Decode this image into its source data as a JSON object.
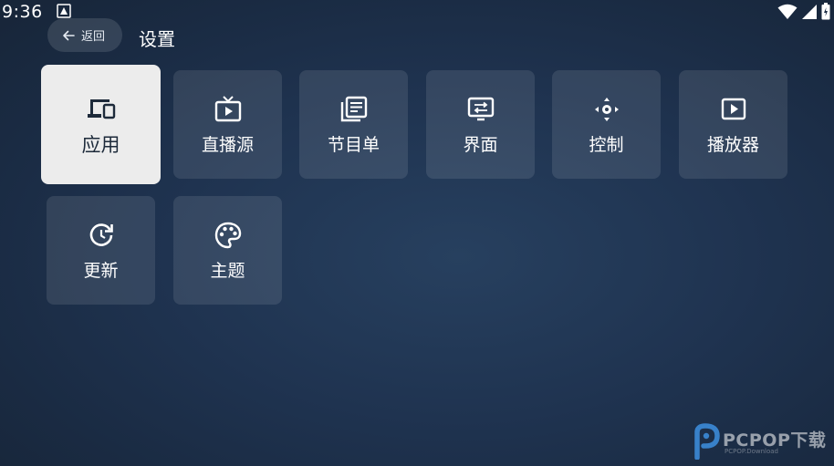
{
  "status_bar": {
    "time": "9:36",
    "icons": [
      "notification-icon",
      "wifi-icon",
      "signal-icon",
      "battery-icon"
    ]
  },
  "header": {
    "back_label": "返回",
    "title": "设置"
  },
  "tiles": [
    {
      "label": "应用",
      "icon": "devices-icon",
      "selected": true
    },
    {
      "label": "直播源",
      "icon": "tv-icon",
      "selected": false
    },
    {
      "label": "节目单",
      "icon": "library-icon",
      "selected": false
    },
    {
      "label": "界面",
      "icon": "display-swap-icon",
      "selected": false
    },
    {
      "label": "控制",
      "icon": "dpad-icon",
      "selected": false
    },
    {
      "label": "播放器",
      "icon": "play-box-icon",
      "selected": false
    },
    {
      "label": "更新",
      "icon": "update-icon",
      "selected": false
    },
    {
      "label": "主题",
      "icon": "palette-icon",
      "selected": false
    }
  ],
  "watermark": {
    "text": "PCPOP下载",
    "subtext": "PCPOP.Download"
  },
  "colors": {
    "tile_bg": "#2f3f55",
    "tile_selected_bg": "#ececec",
    "text_primary": "#ffffff",
    "text_selected": "#1d2a3a"
  }
}
